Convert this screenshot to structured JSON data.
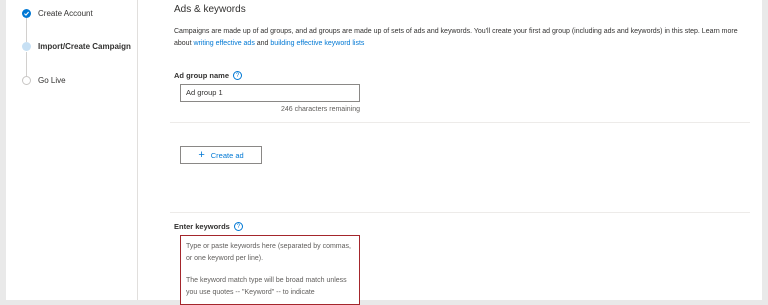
{
  "sidebar": {
    "steps": [
      {
        "label": "Create Account",
        "state": "done"
      },
      {
        "label": "Import/Create Campaign",
        "state": "current"
      },
      {
        "label": "Go Live",
        "state": "future"
      }
    ]
  },
  "main": {
    "title": "Ads & keywords",
    "description_part1": "Campaigns are made up of ad groups, and ad groups are made up of sets of ads and keywords. You'll create your first ad group (including ads and keywords) in this step. Learn more about ",
    "link1": "writing effective ads",
    "description_and": " and ",
    "link2": "building effective keyword lists",
    "ad_group_label": "Ad group name",
    "ad_group_value": "Ad group 1",
    "chars_remaining": "246 characters remaining",
    "create_ad_label": "Create ad",
    "keywords_label": "Enter keywords",
    "keywords_placeholder_p1": "Type or paste keywords here (separated by commas, or one keyword per line).",
    "keywords_placeholder_p2": "The keyword match type will be broad match unless you use quotes -- \"Keyword\" -- to indicate",
    "help_glyph": "?"
  },
  "colors": {
    "accent": "#0078d4",
    "error_border": "#a4262c",
    "step_current": "#c7e0f4"
  }
}
